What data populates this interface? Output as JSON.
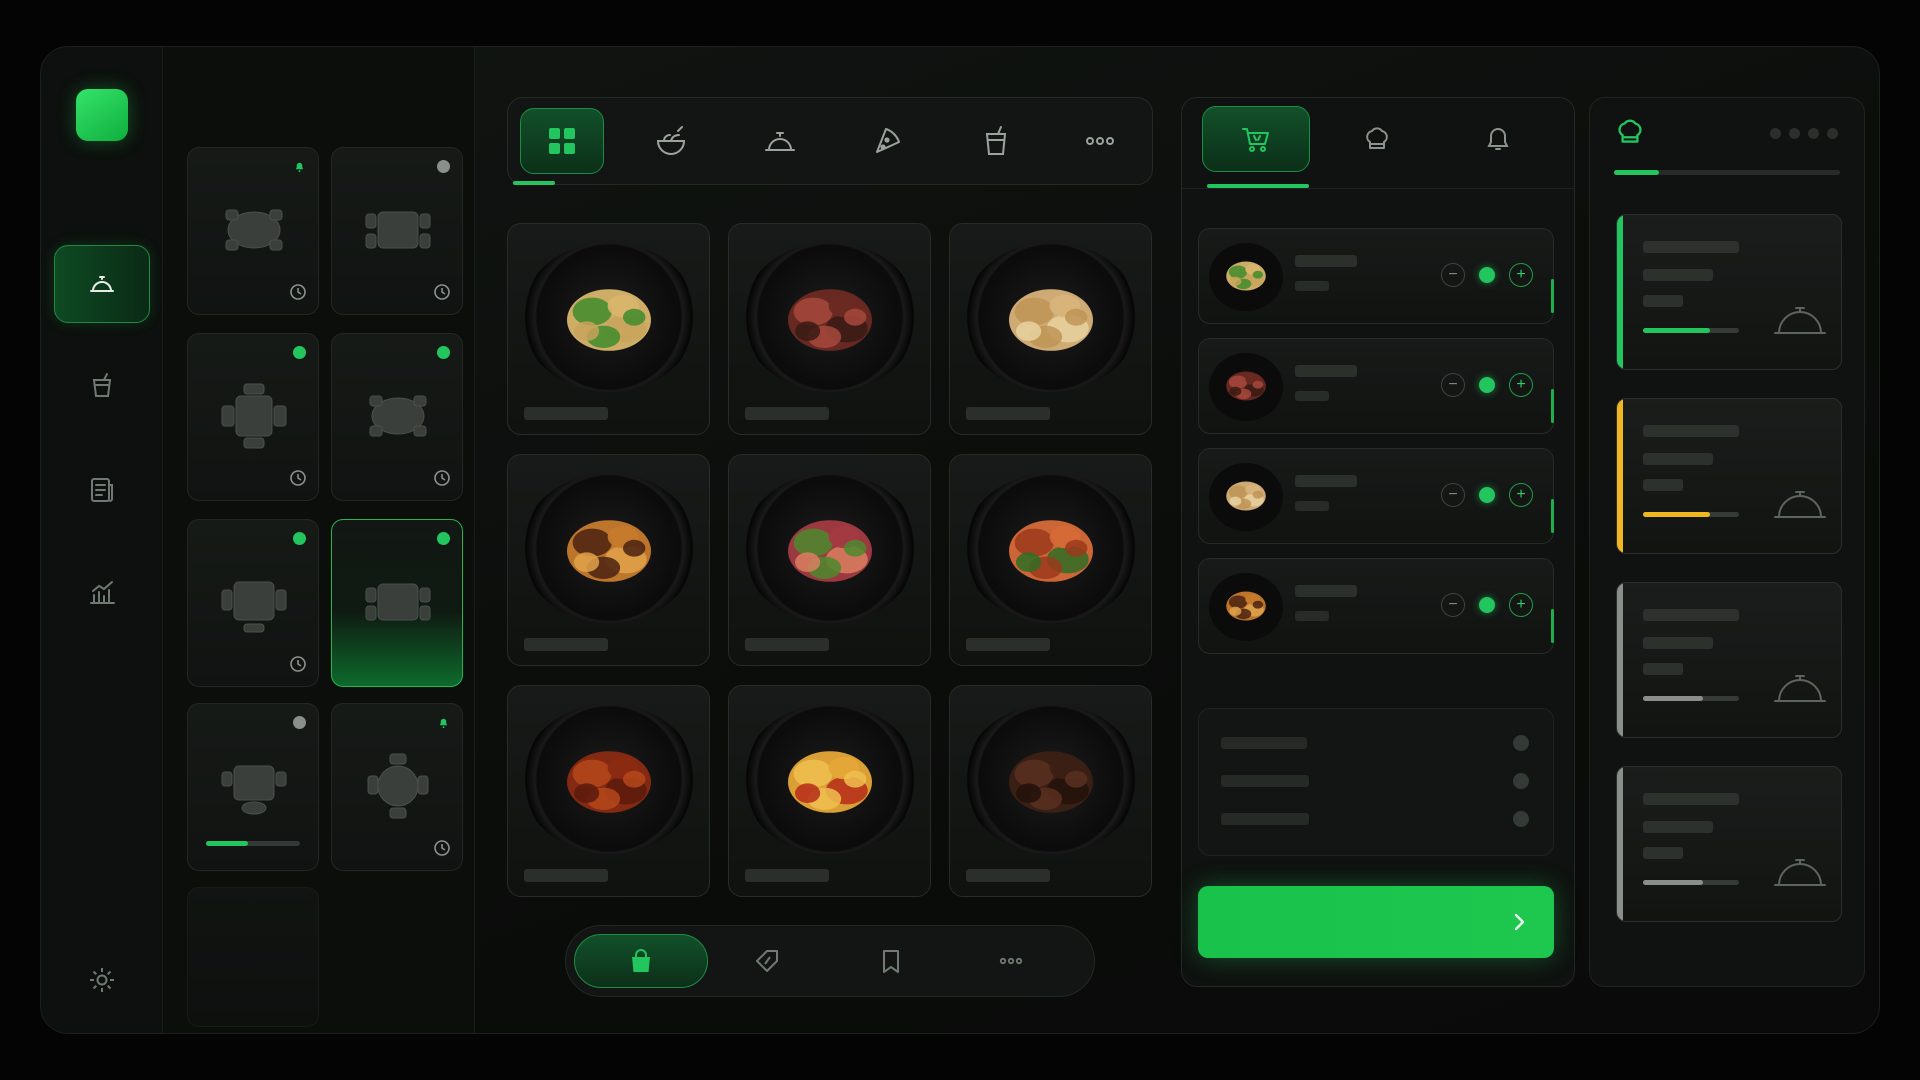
{
  "app": {
    "accent_color": "#22c55e",
    "warning_color": "#f0b820",
    "neutral_color": "#8a8f8b"
  },
  "rail": {
    "logo_icon": "app-logo",
    "items": [
      {
        "icon": "cloche-icon",
        "active": true
      },
      {
        "icon": "drink-cup-icon",
        "active": false
      },
      {
        "icon": "receipt-icon",
        "active": false
      },
      {
        "icon": "analytics-chart-icon",
        "active": false
      }
    ],
    "settings_icon": "gear-icon"
  },
  "tables": [
    {
      "shape": "round",
      "status": "bell",
      "status_color": "#22c55e",
      "timer": true
    },
    {
      "shape": "square",
      "status": "idle",
      "status_color": "#8a8f8b",
      "timer": true
    },
    {
      "shape": "square",
      "status": "occupied",
      "status_color": "#22c55e",
      "timer": true
    },
    {
      "shape": "round",
      "status": "occupied",
      "status_color": "#22c55e",
      "timer": true
    },
    {
      "shape": "square",
      "status": "occupied",
      "status_color": "#22c55e",
      "timer": true
    },
    {
      "shape": "square",
      "status": "occupied",
      "status_color": "#22c55e",
      "timer": false,
      "selected": true
    },
    {
      "shape": "square",
      "status": "idle",
      "status_color": "#8a8f8b",
      "timer": false,
      "progress": 0.45
    },
    {
      "shape": "round",
      "status": "bell",
      "status_color": "#22c55e",
      "timer": true
    },
    {
      "shape": "empty"
    }
  ],
  "categories": [
    {
      "icon": "grid-icon",
      "active": true
    },
    {
      "icon": "salad-bowl-icon",
      "active": false
    },
    {
      "icon": "cloche-icon",
      "active": false
    },
    {
      "icon": "pizza-slice-icon",
      "active": false
    },
    {
      "icon": "drink-cup-icon",
      "active": false
    },
    {
      "icon": "more-dots-icon",
      "active": false
    }
  ],
  "dishes": [
    {
      "food": "caesar-salad",
      "colors": [
        "#d8b56a",
        "#3f8b2b",
        "#c9a35c"
      ]
    },
    {
      "food": "grilled-steak",
      "colors": [
        "#6b2a22",
        "#a8483c",
        "#3a1a14"
      ]
    },
    {
      "food": "pasta",
      "colors": [
        "#d8b37a",
        "#bf9456",
        "#e8d1a0"
      ]
    },
    {
      "food": "burger",
      "colors": [
        "#c67a2c",
        "#4a2212",
        "#e0a34a"
      ]
    },
    {
      "food": "seared-tuna-salad",
      "colors": [
        "#a33a42",
        "#4c8a2e",
        "#d98060"
      ]
    },
    {
      "food": "grilled-salmon",
      "colors": [
        "#d66a38",
        "#9a3a1c",
        "#2f6d24"
      ]
    },
    {
      "food": "chicken-wings",
      "colors": [
        "#8a2a12",
        "#b5481c",
        "#5a1a0c"
      ]
    },
    {
      "food": "french-fries",
      "colors": [
        "#e5a737",
        "#f0c050",
        "#b52b1a"
      ]
    },
    {
      "food": "chocolate-cake",
      "colors": [
        "#3b2014",
        "#5a3020",
        "#22120a"
      ]
    }
  ],
  "bottom_nav": [
    {
      "icon": "shopping-bag-icon",
      "active": true
    },
    {
      "icon": "discount-tag-icon",
      "active": false
    },
    {
      "icon": "bookmark-icon",
      "active": false
    },
    {
      "icon": "more-dots-icon",
      "active": false
    }
  ],
  "order_tabs": [
    {
      "icon": "cart-icon",
      "active": true
    },
    {
      "icon": "chef-hat-icon",
      "active": false
    },
    {
      "icon": "bell-icon",
      "active": false
    }
  ],
  "order_items": [
    {
      "food": "caesar-salad",
      "quantity_indicator": true
    },
    {
      "food": "grilled-steak",
      "quantity_indicator": true
    },
    {
      "food": "pasta",
      "quantity_indicator": true
    },
    {
      "food": "burger",
      "quantity_indicator": true
    }
  ],
  "checkout": {
    "icon": "chevron-right-icon"
  },
  "kitchen": {
    "header_icon": "chef-hat-icon",
    "overall_progress": 0.2,
    "tickets": [
      {
        "accent": "#22c55e",
        "progress": 0.7
      },
      {
        "accent": "#f0b820",
        "progress": 0.7
      },
      {
        "accent": "#8a8f8b",
        "progress": 0.62
      },
      {
        "accent": "#8a8f8b",
        "progress": 0.62
      }
    ]
  }
}
